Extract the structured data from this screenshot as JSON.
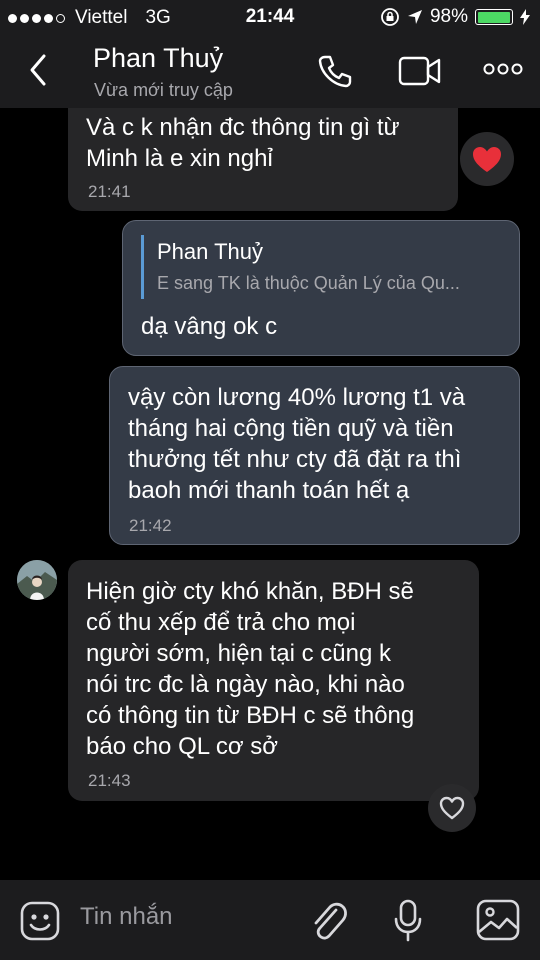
{
  "status_bar": {
    "carrier": "Viettel",
    "network": "3G",
    "time": "21:44",
    "battery": "98%",
    "battery_level": 0.98
  },
  "header": {
    "contact_name": "Phan Thuỷ",
    "status": "Vừa mới truy cập",
    "icons": [
      "back-chevron-icon",
      "phone-icon",
      "video-camera-icon",
      "more-options-icon"
    ]
  },
  "messages": [
    {
      "direction": "incoming",
      "lines": [
        "Và c k nhận đc thông tin gì từ",
        "Minh là e xin nghỉ"
      ],
      "time": "21:41",
      "reaction": "red-heart"
    },
    {
      "direction": "outgoing",
      "reply_to": {
        "author": "Phan Thuỷ",
        "snippet": "E sang TK là thuộc Quản Lý của Qu..."
      },
      "lines": [
        "dạ vâng ok c"
      ]
    },
    {
      "direction": "outgoing",
      "lines": [
        "vậy còn lương 40% lương t1 và",
        "tháng hai cộng tiền quỹ và tiền",
        "thưởng tết như cty đã đặt ra thì",
        "baoh mới thanh toán hết ạ"
      ],
      "time": "21:42"
    },
    {
      "direction": "incoming",
      "lines": [
        "Hiện giờ cty khó khăn, BĐH sẽ",
        "cố thu xếp để trả cho mọi",
        "người sớm, hiện tại c cũng k",
        "nói trc đc là ngày nào, khi nào",
        "có thông tin từ BĐH c sẽ thông",
        "báo cho QL cơ sở"
      ],
      "time": "21:43",
      "reaction": "heart-outline"
    }
  ],
  "composer": {
    "placeholder": "Tin nhắn",
    "icons": [
      "emoji-icon",
      "paperclip-icon",
      "microphone-icon",
      "image-icon"
    ]
  },
  "colors": {
    "background": "#000000",
    "bar": "#1c1c1e",
    "incoming_bubble": "#262628",
    "outgoing_bubble": "#343b47",
    "accent_blue": "#5b9bd5",
    "heart_red": "#e8303a"
  }
}
